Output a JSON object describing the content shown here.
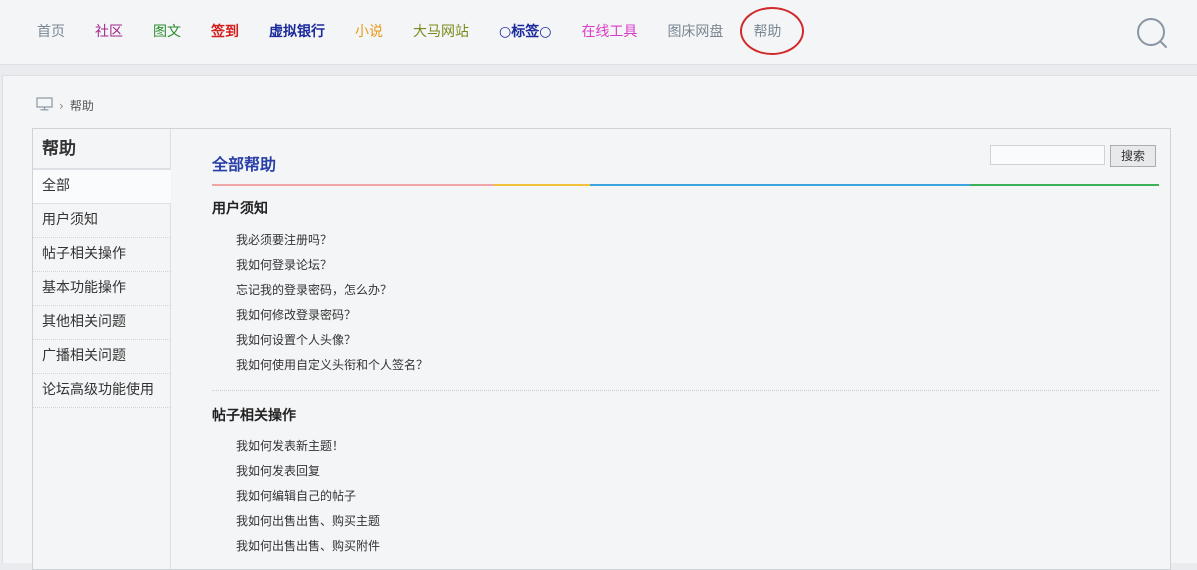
{
  "nav": {
    "items": [
      {
        "label": "首页",
        "color": "#7a8793",
        "bold": false
      },
      {
        "label": "社区",
        "color": "#a0268a",
        "bold": false
      },
      {
        "label": "图文",
        "color": "#2b8c2b",
        "bold": false
      },
      {
        "label": "签到",
        "color": "#d21d1d",
        "bold": true
      },
      {
        "label": "虚拟银行",
        "color": "#1b2a9a",
        "bold": true
      },
      {
        "label": "小说",
        "color": "#e89a1a",
        "bold": false
      },
      {
        "label": "大马网站",
        "color": "#7a8a1a",
        "bold": false
      },
      {
        "label": "○标签○",
        "color": "#1b2a9a",
        "bold": true
      },
      {
        "label": "在线工具",
        "color": "#d93ac8",
        "bold": false
      },
      {
        "label": "图床网盘",
        "color": "#7a8793",
        "bold": false
      },
      {
        "label": "帮助",
        "color": "#7a8793",
        "bold": false
      }
    ],
    "search_icon": "search-icon"
  },
  "breadcrumb": {
    "home_icon": "monitor-icon",
    "separator": "›",
    "current": "帮助"
  },
  "sidebar": {
    "title": "帮助",
    "items": [
      "全部",
      "用户须知",
      "帖子相关操作",
      "基本功能操作",
      "其他相关问题",
      "广播相关问题",
      "论坛高级功能使用"
    ]
  },
  "content": {
    "title": "全部帮助",
    "search_button": "搜索",
    "search_value": "",
    "rainbow_colors": [
      "#f0a6a6",
      "#f3c23c",
      "#3aa3e0",
      "#3fb05a"
    ],
    "sections": [
      {
        "title": "用户须知",
        "questions": [
          "我必须要注册吗？",
          "我如何登录论坛？",
          "忘记我的登录密码，怎么办？",
          "我如何修改登录密码？",
          "我如何设置个人头像？",
          "我如何使用自定义头衔和个人签名？"
        ]
      },
      {
        "title": "帖子相关操作",
        "questions": [
          "我如何发表新主题！",
          "我如何发表回复",
          "我如何编辑自己的帖子",
          "我如何出售出售、购买主题",
          "我如何出售出售、购买附件"
        ]
      }
    ]
  }
}
